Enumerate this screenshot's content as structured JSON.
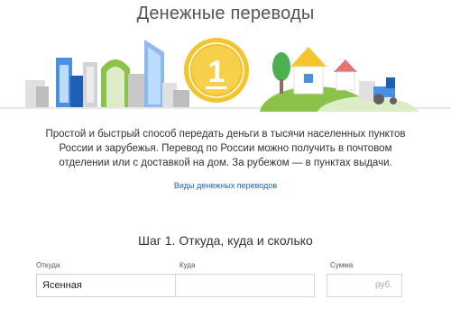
{
  "header": {
    "title": "Денежные переводы"
  },
  "illustration": {
    "coin_label": "1",
    "colors": {
      "coin": "#f3c42b",
      "coin_dark": "#d9a915",
      "green": "#8bc34a",
      "dark_green": "#4caf50",
      "blue": "#4a90e2",
      "light_blue": "#bcdcff",
      "gray": "#d4d4d4",
      "dark_gray": "#9e9e9e",
      "brown": "#8d6e63",
      "roof": "#e57373"
    }
  },
  "intro": {
    "description": "Простой и быстрый способ передать деньги в тысячи населенных пунктов России и зарубежья. Перевод по России можно получить в почтовом отделении или с доставкой на дом. За рубежом — в пунктах выдачи.",
    "link_text": "Виды денежных переводов"
  },
  "form": {
    "step_title": "Шаг 1. Откуда, куда и сколько",
    "from": {
      "label": "Откуда",
      "value": "Ясенная"
    },
    "to": {
      "label": "Куда",
      "value": ""
    },
    "amount": {
      "label": "Сумма",
      "value": "",
      "suffix": "руб."
    }
  }
}
